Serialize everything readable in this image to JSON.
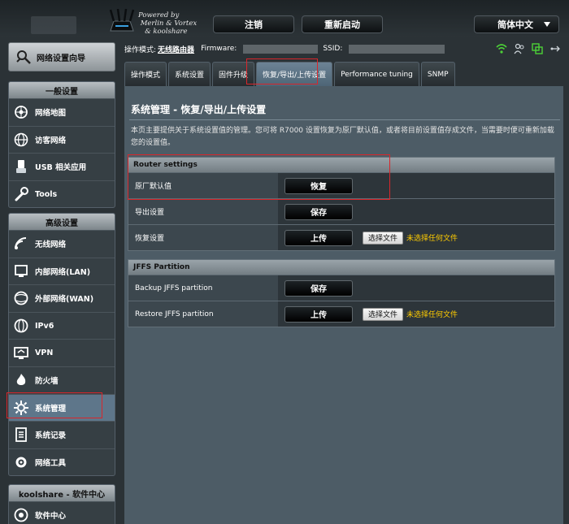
{
  "header": {
    "powered_by": "Powered by\n Merlin & Vortex\n   & koolshare",
    "logout_label": "注销",
    "reboot_label": "重新启动",
    "language_label": "简体中文"
  },
  "status": {
    "mode_key": "操作模式:",
    "mode_value": "无线路由器",
    "firmware_key": "Firmware:",
    "ssid_key": "SSID:"
  },
  "sidebar": {
    "quick_setup_label": "网络设置向导",
    "general_title": "一般设置",
    "general_items": [
      {
        "label": "网络地图",
        "icon": "network-map-icon"
      },
      {
        "label": "访客网络",
        "icon": "guest-network-icon"
      },
      {
        "label": "USB 相关应用",
        "icon": "usb-icon"
      },
      {
        "label": "Tools",
        "icon": "tools-icon"
      }
    ],
    "advanced_title": "高级设置",
    "advanced_items": [
      {
        "label": "无线网络",
        "icon": "wireless-icon"
      },
      {
        "label": "内部网络(LAN)",
        "icon": "lan-icon"
      },
      {
        "label": "外部网络(WAN)",
        "icon": "wan-icon"
      },
      {
        "label": "IPv6",
        "icon": "ipv6-icon"
      },
      {
        "label": "VPN",
        "icon": "vpn-icon"
      },
      {
        "label": "防火墙",
        "icon": "firewall-icon"
      },
      {
        "label": "系统管理",
        "icon": "administration-icon"
      },
      {
        "label": "系统记录",
        "icon": "system-log-icon"
      },
      {
        "label": "网络工具",
        "icon": "network-tools-icon"
      }
    ],
    "koolshare_title": "koolshare - 软件中心",
    "koolshare_items": [
      {
        "label": "软件中心",
        "icon": "software-center-icon"
      }
    ]
  },
  "tabs": [
    {
      "label": "操作模式"
    },
    {
      "label": "系统设置"
    },
    {
      "label": "固件升级"
    },
    {
      "label": "恢复/导出/上传设置"
    },
    {
      "label": "Performance tuning"
    },
    {
      "label": "SNMP"
    }
  ],
  "panel": {
    "title": "系统管理 - 恢复/导出/上传设置",
    "description": "本页主要提供关于系统设置值的管理。您可将 R7000 设置恢复为原厂默认值，或者将目前设置值存成文件，当需要时便可重新加载您的设置值。"
  },
  "router_settings": {
    "title": "Router settings",
    "rows": [
      {
        "label": "原厂默认值",
        "button": "恢复"
      },
      {
        "label": "导出设置",
        "button": "保存"
      },
      {
        "label": "恢复设置",
        "button": "上传",
        "file_button": "选择文件",
        "file_status": "未选择任何文件"
      }
    ]
  },
  "jffs": {
    "title": "JFFS Partition",
    "rows": [
      {
        "label": "Backup JFFS partition",
        "button": "保存"
      },
      {
        "label": "Restore JFFS partition",
        "button": "上传",
        "file_button": "选择文件",
        "file_status": "未选择任何文件"
      }
    ]
  },
  "colors": {
    "annotation": "#d9262b",
    "active_tab": "#5e768a",
    "file_status": "#ffcc00"
  }
}
